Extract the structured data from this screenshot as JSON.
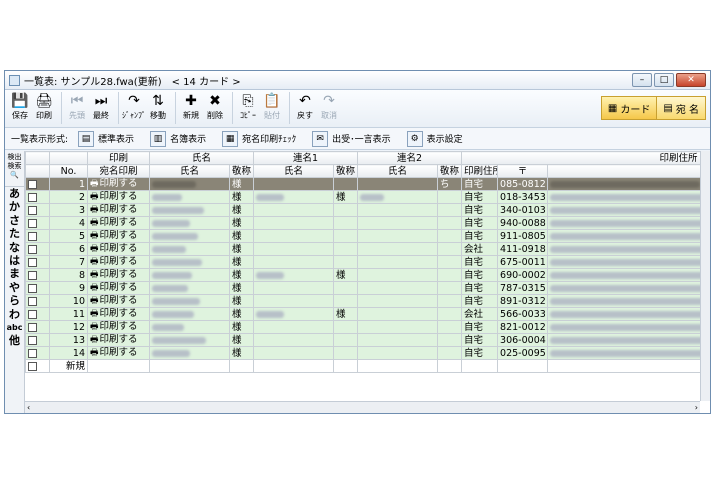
{
  "window": {
    "title": "一覧表: サンプル28.fwa(更新)",
    "card_count": "< 14 カード >",
    "min": "–",
    "max": "□",
    "close": "✕"
  },
  "toolbar": [
    {
      "label": "保存",
      "icon": "save-icon",
      "glyph": "💾",
      "dim": false
    },
    {
      "label": "印刷",
      "icon": "printer-icon",
      "glyph": "🖨",
      "dim": false
    },
    {
      "label": "先頭",
      "icon": "first-icon",
      "glyph": "⏮",
      "dim": true
    },
    {
      "label": "最終",
      "icon": "last-icon",
      "glyph": "⏭",
      "dim": false
    },
    {
      "label": "ｼﾞｬﾝﾌﾟ",
      "icon": "jump-icon",
      "glyph": "↷",
      "dim": false
    },
    {
      "label": "移動",
      "icon": "move-icon",
      "glyph": "⇅",
      "dim": false
    },
    {
      "label": "新規",
      "icon": "new-icon",
      "glyph": "✚",
      "dim": false
    },
    {
      "label": "削除",
      "icon": "delete-icon",
      "glyph": "✖",
      "dim": false
    },
    {
      "label": "ｺﾋﾟｰ",
      "icon": "copy-icon",
      "glyph": "⎘",
      "dim": false
    },
    {
      "label": "貼付",
      "icon": "paste-icon",
      "glyph": "📋",
      "dim": true
    },
    {
      "label": "戻す",
      "icon": "undo-icon",
      "glyph": "↶",
      "dim": false
    },
    {
      "label": "取消",
      "icon": "redo-icon",
      "glyph": "↷",
      "dim": true
    }
  ],
  "modes": {
    "card": "カード",
    "address": "宛 名"
  },
  "viewbar": {
    "label": "一覧表示形式:",
    "buttons": [
      "標準表示",
      "名簿表示",
      "宛名印刷ﾁｪｯｸ",
      "出受･一言表示",
      "表示設定"
    ]
  },
  "index": {
    "search": [
      "検出",
      "検索"
    ],
    "items": [
      "あ",
      "か",
      "さ",
      "た",
      "な",
      "は",
      "ま",
      "や",
      "ら",
      "わ",
      "abc",
      "他"
    ]
  },
  "columns": {
    "group_row": [
      "",
      "",
      "印刷",
      "氏名",
      "",
      "連名1",
      "",
      "連名2",
      "",
      "",
      "印刷住所"
    ],
    "header_row": [
      "",
      "No.",
      "宛名印刷",
      "氏名",
      "敬称",
      "氏名",
      "敬称",
      "氏名",
      "敬称",
      "印刷住所",
      "〒",
      "住所"
    ]
  },
  "rows": [
    {
      "no": "1",
      "print": "印刷する",
      "keisho": "様",
      "r1": "",
      "r1k": "",
      "r2": "",
      "r2k": "ち",
      "addr": "自宅",
      "zip": "085-0812",
      "selected": true
    },
    {
      "no": "2",
      "print": "印刷する",
      "keisho": "様",
      "r1": "x",
      "r1k": "様",
      "r2": "x",
      "r2k": "",
      "addr": "自宅",
      "zip": "018-3453"
    },
    {
      "no": "3",
      "print": "印刷する",
      "keisho": "様",
      "r1": "",
      "r1k": "",
      "r2": "",
      "r2k": "",
      "addr": "自宅",
      "zip": "340-0103"
    },
    {
      "no": "4",
      "print": "印刷する",
      "keisho": "様",
      "r1": "",
      "r1k": "",
      "r2": "",
      "r2k": "",
      "addr": "自宅",
      "zip": "940-0088"
    },
    {
      "no": "5",
      "print": "印刷する",
      "keisho": "様",
      "r1": "",
      "r1k": "",
      "r2": "",
      "r2k": "",
      "addr": "自宅",
      "zip": "911-0805"
    },
    {
      "no": "6",
      "print": "印刷する",
      "keisho": "様",
      "r1": "",
      "r1k": "",
      "r2": "",
      "r2k": "",
      "addr": "会社",
      "zip": "411-0918"
    },
    {
      "no": "7",
      "print": "印刷する",
      "keisho": "様",
      "r1": "",
      "r1k": "",
      "r2": "",
      "r2k": "",
      "addr": "自宅",
      "zip": "675-0011"
    },
    {
      "no": "8",
      "print": "印刷する",
      "keisho": "様",
      "r1": "x",
      "r1k": "様",
      "r2": "",
      "r2k": "",
      "addr": "自宅",
      "zip": "690-0002"
    },
    {
      "no": "9",
      "print": "印刷する",
      "keisho": "様",
      "r1": "",
      "r1k": "",
      "r2": "",
      "r2k": "",
      "addr": "自宅",
      "zip": "787-0315"
    },
    {
      "no": "10",
      "print": "印刷する",
      "keisho": "様",
      "r1": "",
      "r1k": "",
      "r2": "",
      "r2k": "",
      "addr": "自宅",
      "zip": "891-0312"
    },
    {
      "no": "11",
      "print": "印刷する",
      "keisho": "様",
      "r1": "x",
      "r1k": "様",
      "r2": "",
      "r2k": "",
      "addr": "会社",
      "zip": "566-0033"
    },
    {
      "no": "12",
      "print": "印刷する",
      "keisho": "様",
      "r1": "",
      "r1k": "",
      "r2": "",
      "r2k": "",
      "addr": "自宅",
      "zip": "821-0012"
    },
    {
      "no": "13",
      "print": "印刷する",
      "keisho": "様",
      "r1": "",
      "r1k": "",
      "r2": "",
      "r2k": "",
      "addr": "自宅",
      "zip": "306-0004"
    },
    {
      "no": "14",
      "print": "印刷する",
      "keisho": "様",
      "r1": "",
      "r1k": "",
      "r2": "",
      "r2k": "",
      "addr": "自宅",
      "zip": "025-0095"
    }
  ],
  "new_row_label": "新規",
  "hscroll": {
    "left": "‹",
    "right": "›"
  }
}
